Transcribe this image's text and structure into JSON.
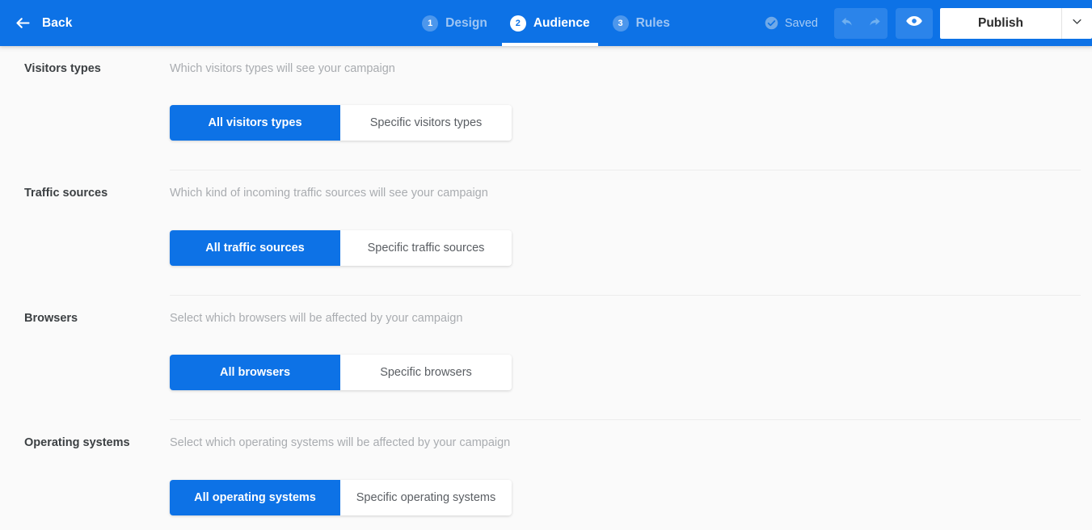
{
  "header": {
    "back_label": "Back",
    "back_icon": "arrow-left-icon",
    "steps": [
      {
        "num": "1",
        "label": "Design",
        "active": false
      },
      {
        "num": "2",
        "label": "Audience",
        "active": true
      },
      {
        "num": "3",
        "label": "Rules",
        "active": false
      }
    ],
    "saved_label": "Saved",
    "saved_icon": "check-circle-icon",
    "undo_icon": "undo-arrow-icon",
    "redo_icon": "redo-arrow-icon",
    "preview_icon": "eye-icon",
    "publish_label": "Publish",
    "publish_caret_icon": "chevron-down-icon",
    "accent_color": "#0d72e6",
    "header_bg": "#0d72e6"
  },
  "sections": [
    {
      "label": "Visitors types",
      "description": "Which visitors types will see your campaign",
      "options": [
        {
          "label": "All visitors types",
          "selected": true
        },
        {
          "label": "Specific visitors types",
          "selected": false
        }
      ]
    },
    {
      "label": "Traffic sources",
      "description": "Which kind of incoming traffic sources will see your campaign",
      "options": [
        {
          "label": "All traffic sources",
          "selected": true
        },
        {
          "label": "Specific traffic sources",
          "selected": false
        }
      ]
    },
    {
      "label": "Browsers",
      "description": "Select which browsers will be affected by your campaign",
      "options": [
        {
          "label": "All browsers",
          "selected": true
        },
        {
          "label": "Specific browsers",
          "selected": false
        }
      ]
    },
    {
      "label": "Operating systems",
      "description": "Select which operating systems will be affected by your campaign",
      "options": [
        {
          "label": "All operating systems",
          "selected": true
        },
        {
          "label": "Specific operating systems",
          "selected": false
        }
      ]
    }
  ]
}
